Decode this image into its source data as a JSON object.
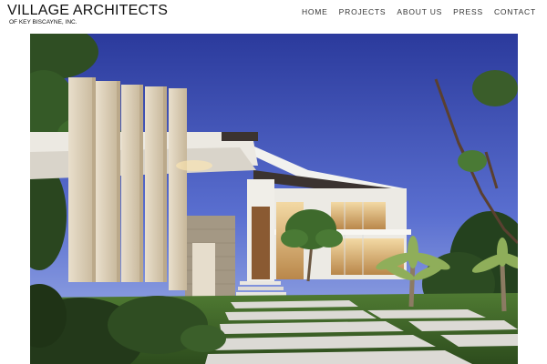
{
  "brand": {
    "title": "VILLAGE ARCHITECTS",
    "subtitle": "OF KEY BISCAYNE, INC."
  },
  "nav": {
    "items": [
      {
        "label": "HOME"
      },
      {
        "label": "PROJECTS"
      },
      {
        "label": "ABOUT US"
      },
      {
        "label": "PRESS"
      },
      {
        "label": "CONTACT"
      }
    ]
  },
  "colors": {
    "sky_top": "#2a3a9a",
    "sky_bottom": "#9fb0e8",
    "stone": "#d9cdb8",
    "wall": "#e8e6e0",
    "lawn": "#3f6b2a"
  }
}
